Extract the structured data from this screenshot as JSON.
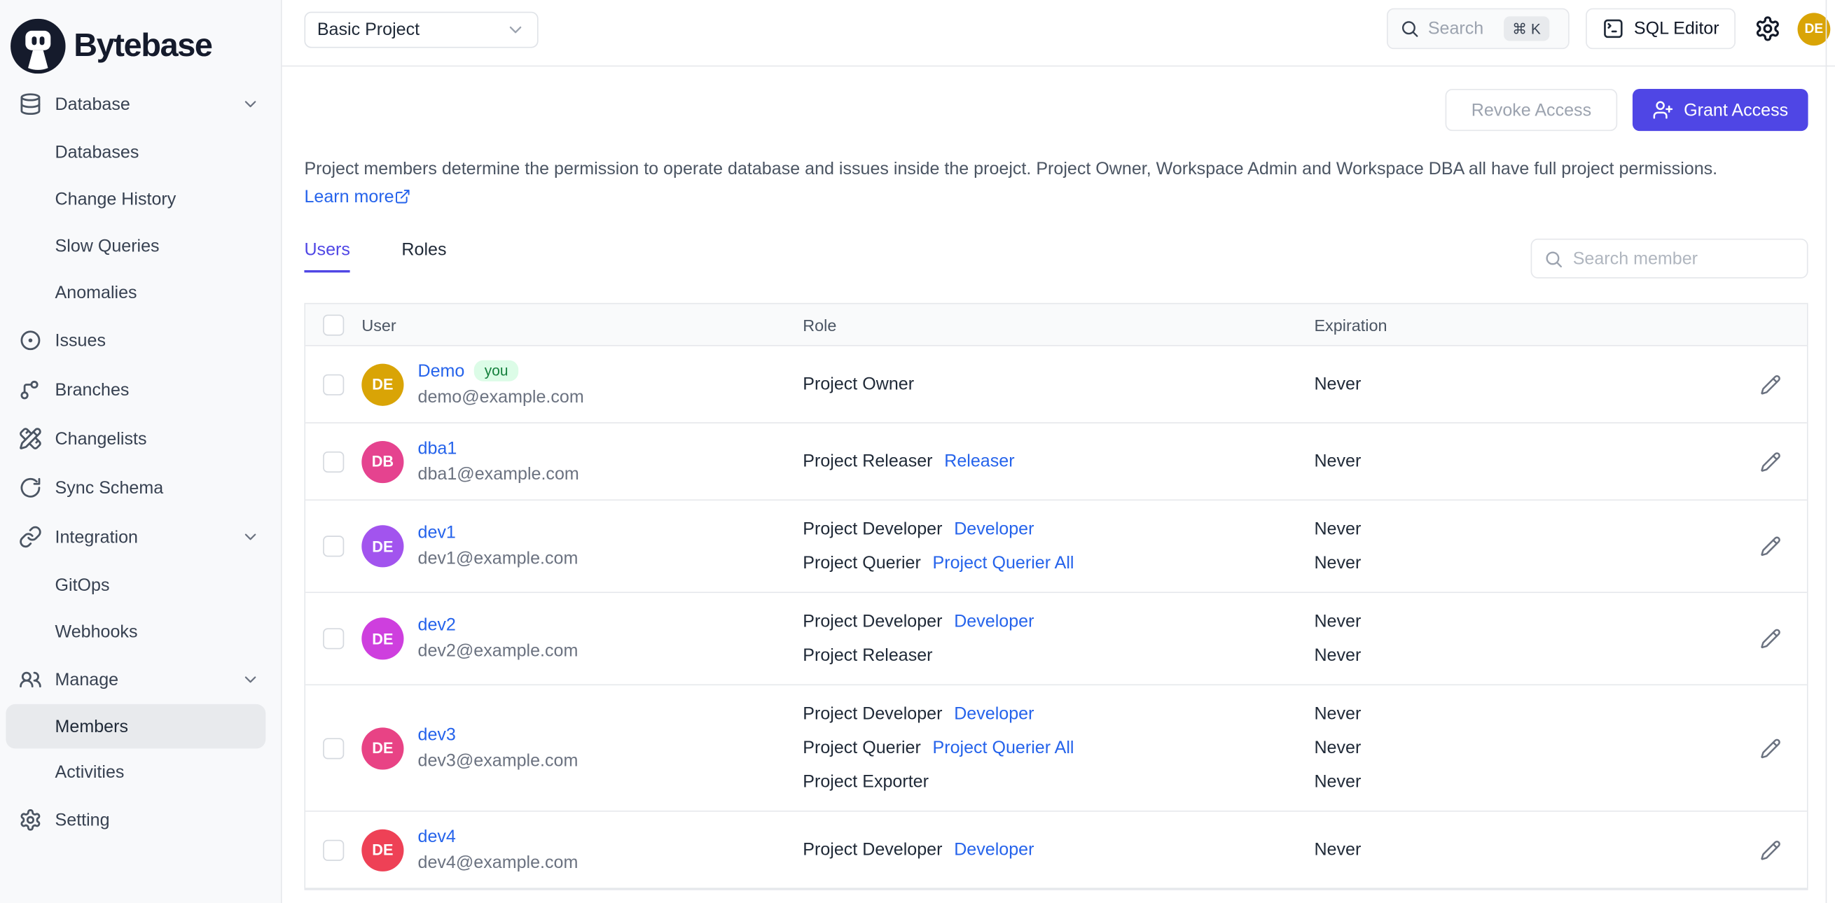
{
  "app": {
    "logo_text": "Bytebase"
  },
  "topbar": {
    "project_selector": "Basic Project",
    "search_placeholder": "Search",
    "search_shortcut": "⌘ K",
    "sql_editor_label": "SQL Editor",
    "avatar_initials": "DE",
    "avatar_color": "#D9A406"
  },
  "sidebar": {
    "items": [
      {
        "label": "Database"
      },
      {
        "label": "Databases"
      },
      {
        "label": "Change History"
      },
      {
        "label": "Slow Queries"
      },
      {
        "label": "Anomalies"
      },
      {
        "label": "Issues"
      },
      {
        "label": "Branches"
      },
      {
        "label": "Changelists"
      },
      {
        "label": "Sync Schema"
      },
      {
        "label": "Integration"
      },
      {
        "label": "GitOps"
      },
      {
        "label": "Webhooks"
      },
      {
        "label": "Manage"
      },
      {
        "label": "Members"
      },
      {
        "label": "Activities"
      },
      {
        "label": "Setting"
      }
    ]
  },
  "main": {
    "revoke_button": "Revoke Access",
    "grant_button": "Grant Access",
    "description": "Project members determine the permission to operate database and issues inside the proejct. Project Owner, Workspace Admin and Workspace DBA all have full project permissions.",
    "learn_more": "Learn more",
    "tabs": [
      {
        "label": "Users"
      },
      {
        "label": "Roles"
      }
    ],
    "member_search_placeholder": "Search member",
    "table": {
      "headers": {
        "user": "User",
        "role": "Role",
        "expiration": "Expiration"
      },
      "members": [
        {
          "initials": "DE",
          "name": "Demo",
          "badge": "you",
          "email": "demo@example.com",
          "avatar_color": "#D9A406",
          "roles": [
            {
              "base": "Project Owner",
              "expiration": "Never"
            }
          ]
        },
        {
          "initials": "DB",
          "name": "dba1",
          "email": "dba1@example.com",
          "avatar_color": "#E5438F",
          "roles": [
            {
              "base": "Project Releaser",
              "link": "Releaser",
              "expiration": "Never"
            }
          ]
        },
        {
          "initials": "DE",
          "name": "dev1",
          "email": "dev1@example.com",
          "avatar_color": "#A254EE",
          "roles": [
            {
              "base": "Project Developer",
              "link": "Developer",
              "expiration": "Never"
            },
            {
              "base": "Project Querier",
              "link": "Project Querier All",
              "expiration": "Never"
            }
          ]
        },
        {
          "initials": "DE",
          "name": "dev2",
          "email": "dev2@example.com",
          "avatar_color": "#CE3FDE",
          "roles": [
            {
              "base": "Project Developer",
              "link": "Developer",
              "expiration": "Never"
            },
            {
              "base": "Project Releaser",
              "expiration": "Never"
            }
          ]
        },
        {
          "initials": "DE",
          "name": "dev3",
          "email": "dev3@example.com",
          "avatar_color": "#E84385",
          "roles": [
            {
              "base": "Project Developer",
              "link": "Developer",
              "expiration": "Never"
            },
            {
              "base": "Project Querier",
              "link": "Project Querier All",
              "expiration": "Never"
            },
            {
              "base": "Project Exporter",
              "expiration": "Never"
            }
          ]
        },
        {
          "initials": "DE",
          "name": "dev4",
          "email": "dev4@example.com",
          "avatar_color": "#EE4156",
          "roles": [
            {
              "base": "Project Developer",
              "link": "Developer",
              "expiration": "Never"
            }
          ]
        }
      ]
    }
  }
}
